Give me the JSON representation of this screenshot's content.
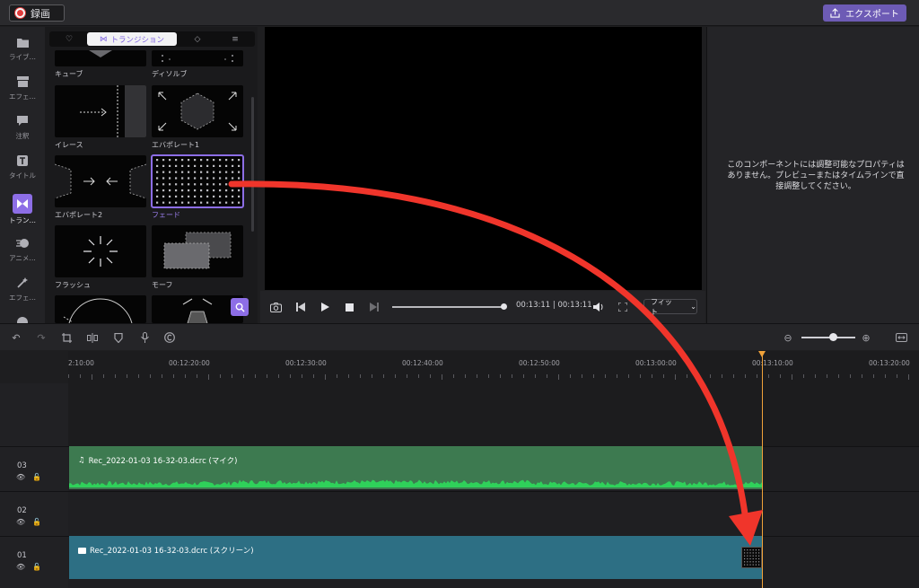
{
  "topbar": {
    "record_label": "録画",
    "export_label": "エクスポート"
  },
  "rail": {
    "items": [
      {
        "label": "ライブ…",
        "icon": "folder-icon"
      },
      {
        "label": "エフェ…",
        "icon": "store-icon"
      },
      {
        "label": "注釈",
        "icon": "speech-icon"
      },
      {
        "label": "タイトル",
        "icon": "title-icon"
      },
      {
        "label": "トラン…",
        "icon": "transition-icon"
      },
      {
        "label": "アニメ…",
        "icon": "animation-icon"
      },
      {
        "label": "エフェ…",
        "icon": "wand-icon"
      }
    ]
  },
  "panel": {
    "tabs": [
      {
        "icon": "heart-icon"
      },
      {
        "label": "トランジション",
        "icon": "bowtie-icon"
      },
      {
        "icon": "diamond-icon"
      },
      {
        "icon": "list-icon"
      }
    ],
    "tiles": [
      {
        "label": "キューブ"
      },
      {
        "label": "ディソルブ"
      },
      {
        "label": "イレース"
      },
      {
        "label": "エバポレート1"
      },
      {
        "label": "エバポレート2"
      },
      {
        "label": "フェード"
      },
      {
        "label": "フラッシュ"
      },
      {
        "label": "モーフ"
      }
    ]
  },
  "transport": {
    "timecode": "00:13:11 | 00:13:11",
    "fit_label": "フィット"
  },
  "props": {
    "message": "このコンポーネントには調整可能なプロパティはありません。プレビューまたはタイムラインで直接調整してください。"
  },
  "ruler": {
    "labels": [
      "2:10:00",
      "00:12:20:00",
      "00:12:30:00",
      "00:12:40:00",
      "00:12:50:00",
      "00:13:00:00",
      "00:13:10:00",
      "00:13:20:00"
    ]
  },
  "tracks": [
    {
      "num": "03",
      "clip": "Rec_2022-01-03 16-32-03.dcrc (マイク)"
    },
    {
      "num": "02",
      "clip": ""
    },
    {
      "num": "01",
      "clip": "Rec_2022-01-03 16-32-03.dcrc (スクリーン)"
    }
  ],
  "colors": {
    "accent": "#8d6ee6",
    "audio_clip": "#3d7a50",
    "screen_clip": "#2d6f84",
    "playhead": "#f0a23a",
    "annotation_arrow": "#f0352b"
  }
}
